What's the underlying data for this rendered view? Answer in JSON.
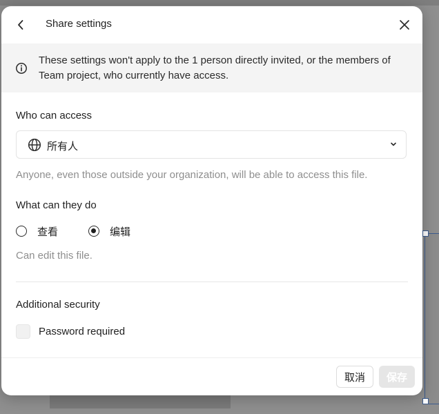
{
  "dialog": {
    "title": "Share settings",
    "notice": "These settings won't apply to the 1 person directly invited, or the members of Team project, who currently have access."
  },
  "access": {
    "label": "Who can access",
    "selected": "所有人",
    "help": "Anyone, even those outside your organization, will be able to access this file."
  },
  "permissions": {
    "label": "What can they do",
    "options": [
      {
        "label": "查看",
        "selected": false
      },
      {
        "label": "编辑",
        "selected": true
      }
    ],
    "help": "Can edit this file."
  },
  "security": {
    "label": "Additional security",
    "password_label": "Password required",
    "password_checked": false
  },
  "footer": {
    "cancel_label": "取消",
    "save_label": "保存",
    "save_enabled": false
  },
  "icons": {
    "back": "chevron-left-icon",
    "close": "close-icon",
    "info": "info-icon",
    "globe": "globe-icon",
    "dropdown": "chevron-down-icon"
  }
}
